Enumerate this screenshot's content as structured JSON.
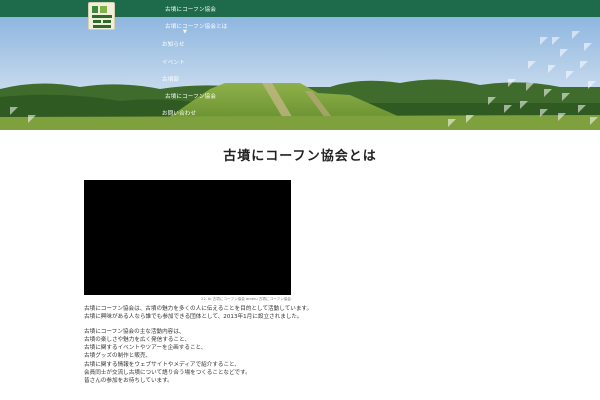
{
  "nav": {
    "logo_text": "古墳にコーフン協会",
    "items": [
      {
        "label": "古墳にコーフン協会"
      },
      {
        "label": "古墳にコーフン協会とは"
      },
      {
        "label": "お知らせ"
      },
      {
        "label": "イベント"
      },
      {
        "label": "古墳部"
      },
      {
        "label": "古墳にコーフン協会"
      },
      {
        "label": "お問い合わせ"
      }
    ]
  },
  "page": {
    "title": "古墳にコーフン協会とは"
  },
  "video": {
    "caption": "22. tk 古墳にコーフン協会 ameru 古墳にコーフン協会"
  },
  "content": {
    "intro_lines": [
      "古墳にコーフン協会は、古墳の魅力を多くの人に伝えることを目的として活動しています。",
      "古墳に興味がある人なら誰でも参加できる団体として、2013年1月に設立されました。"
    ],
    "list_lines": [
      "古墳にコーフン協会の主な活動内容は、",
      "古墳の楽しさや魅力を広く発信すること、",
      "古墳に関するイベントやツアーを企画すること、",
      "古墳グッズの制作と販売、",
      "古墳に関する情報をウェブサイトやメディアで紹介すること、",
      "会員同士が交流し古墳について語り合う場をつくることなどです。",
      "皆さんの参加をお待ちしています。"
    ]
  },
  "colors": {
    "nav_bg": "#1d6b4b",
    "video_bg": "#000000"
  }
}
